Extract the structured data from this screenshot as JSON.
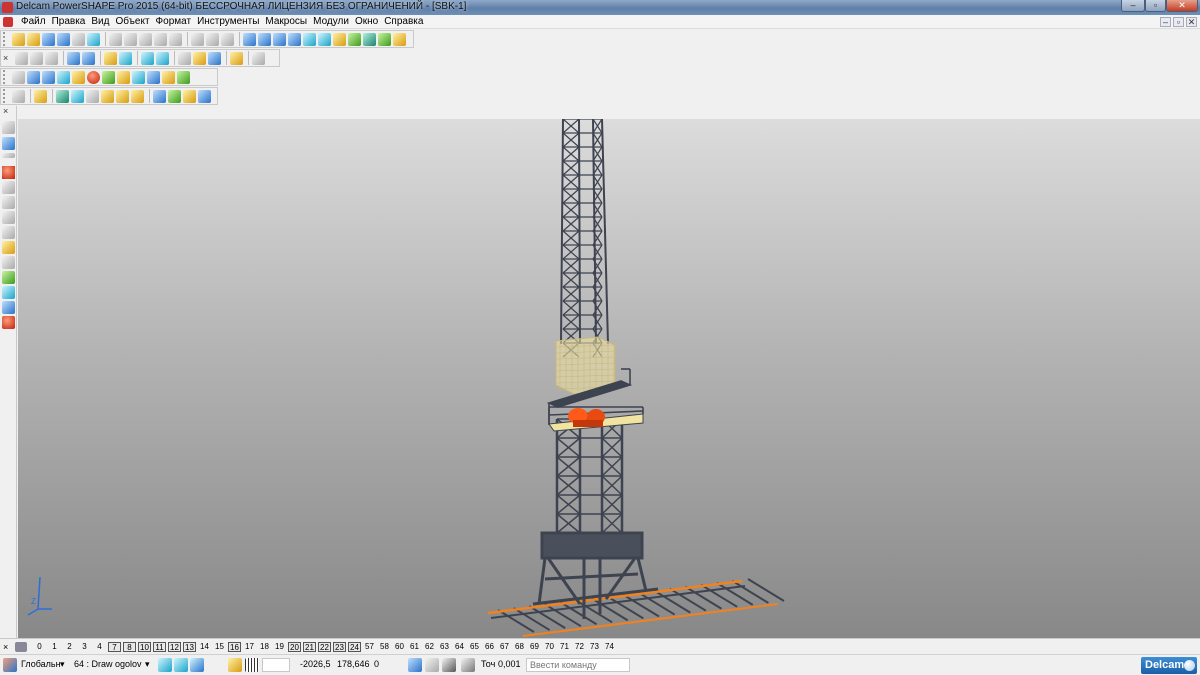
{
  "window": {
    "title": "Delcam PowerSHAPE Pro 2015 (64-bit) БЕССРОЧНАЯ ЛИЦЕНЗИЯ БЕЗ ОГРАНИЧЕНИЙ - [SBK-1]",
    "minimize": "–",
    "maximize": "▫",
    "close": "✕"
  },
  "menu": {
    "items": [
      "Файл",
      "Правка",
      "Вид",
      "Объект",
      "Формат",
      "Инструменты",
      "Макросы",
      "Модули",
      "Окно",
      "Справка"
    ],
    "doc_min": "–",
    "doc_restore": "▫",
    "doc_close": "✕"
  },
  "toolbars": {
    "close_glyph": "×"
  },
  "levels": {
    "items": [
      {
        "label": "0",
        "on": false
      },
      {
        "label": "1",
        "on": false
      },
      {
        "label": "2",
        "on": false
      },
      {
        "label": "3",
        "on": false
      },
      {
        "label": "4",
        "on": false
      },
      {
        "label": "7",
        "on": true
      },
      {
        "label": "8",
        "on": true
      },
      {
        "label": "10",
        "on": true
      },
      {
        "label": "11",
        "on": true
      },
      {
        "label": "12",
        "on": true
      },
      {
        "label": "13",
        "on": true
      },
      {
        "label": "14",
        "on": false
      },
      {
        "label": "15",
        "on": false
      },
      {
        "label": "16",
        "on": true
      },
      {
        "label": "17",
        "on": false
      },
      {
        "label": "18",
        "on": false
      },
      {
        "label": "19",
        "on": false
      },
      {
        "label": "20",
        "on": true
      },
      {
        "label": "21",
        "on": true
      },
      {
        "label": "22",
        "on": true
      },
      {
        "label": "23",
        "on": true
      },
      {
        "label": "24",
        "on": true
      },
      {
        "label": "57",
        "on": false
      },
      {
        "label": "58",
        "on": false
      },
      {
        "label": "60",
        "on": false
      },
      {
        "label": "61",
        "on": false
      },
      {
        "label": "62",
        "on": false
      },
      {
        "label": "63",
        "on": false
      },
      {
        "label": "64",
        "on": false
      },
      {
        "label": "65",
        "on": false
      },
      {
        "label": "66",
        "on": false
      },
      {
        "label": "67",
        "on": false
      },
      {
        "label": "68",
        "on": false
      },
      {
        "label": "69",
        "on": false
      },
      {
        "label": "70",
        "on": false
      },
      {
        "label": "71",
        "on": false
      },
      {
        "label": "72",
        "on": false
      },
      {
        "label": "73",
        "on": false
      },
      {
        "label": "74",
        "on": false
      }
    ]
  },
  "status": {
    "workplane": "Глобальн",
    "level": "64 : Draw ogolov",
    "x": "-2026,5",
    "y": "178,646",
    "z": "0",
    "tolerance_label": "Точ",
    "tolerance": "0,001",
    "command_placeholder": "Ввести команду",
    "brand": "Delcam"
  },
  "viewport": {
    "axis_label": "Z"
  },
  "colors": {
    "viewport_top": "#dcdcdc",
    "viewport_bottom": "#888888",
    "tower": "#3e4350",
    "platform": "#f1e3a0",
    "motor": "#ff5a1a",
    "rail_accent": "#f2821e"
  }
}
